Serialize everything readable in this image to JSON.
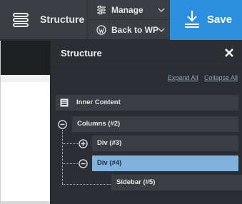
{
  "toolbar": {
    "structure_label": "Structure",
    "manage_label": "Manage",
    "back_label": "Back to WP",
    "save_label": "Save"
  },
  "panel": {
    "title": "Structure",
    "expand_all": "Expand All",
    "collapse_all": "Collapse All",
    "nodes": [
      {
        "label": "Inner Content"
      },
      {
        "label": "Columns (#2)"
      },
      {
        "label": "Div (#3)"
      },
      {
        "label": "Div (#4)"
      },
      {
        "label": "Sidebar (#5)"
      }
    ]
  },
  "icons": {
    "structure": "structure-icon",
    "manage": "sliders-icon",
    "back": "wordpress-icon",
    "save": "download-icon",
    "close": "close-icon"
  },
  "colors": {
    "accent": "#2c8fdf",
    "selected": "#7fb2dc",
    "panel_bg": "#2b2e32",
    "node_bg": "#3a3e43"
  }
}
